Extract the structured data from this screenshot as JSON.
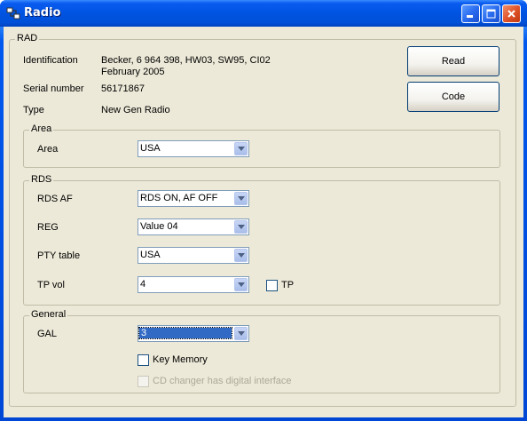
{
  "window": {
    "title": "Radio"
  },
  "buttons": {
    "read": "Read",
    "code": "Code"
  },
  "rad": {
    "label": "RAD",
    "identification_label": "Identification",
    "identification_line1": "Becker,  6 964 398,  HW03,  SW95,  CI02",
    "identification_line2": "February 2005",
    "serial_label": "Serial number",
    "serial_value": "56171867",
    "type_label": "Type",
    "type_value": "New Gen Radio"
  },
  "area": {
    "label": "Area",
    "field_label": "Area",
    "value": "USA"
  },
  "rds": {
    "label": "RDS",
    "rds_af_label": "RDS AF",
    "rds_af_value": "RDS ON, AF OFF",
    "reg_label": "REG",
    "reg_value": "Value 04",
    "pty_label": "PTY table",
    "pty_value": "USA",
    "tpvol_label": "TP vol",
    "tpvol_value": "4",
    "tp_check_label": "TP"
  },
  "general": {
    "label": "General",
    "gal_label": "GAL",
    "gal_value": "3",
    "key_memory_label": "Key Memory",
    "cd_changer_label": "CD changer has digital interface"
  }
}
